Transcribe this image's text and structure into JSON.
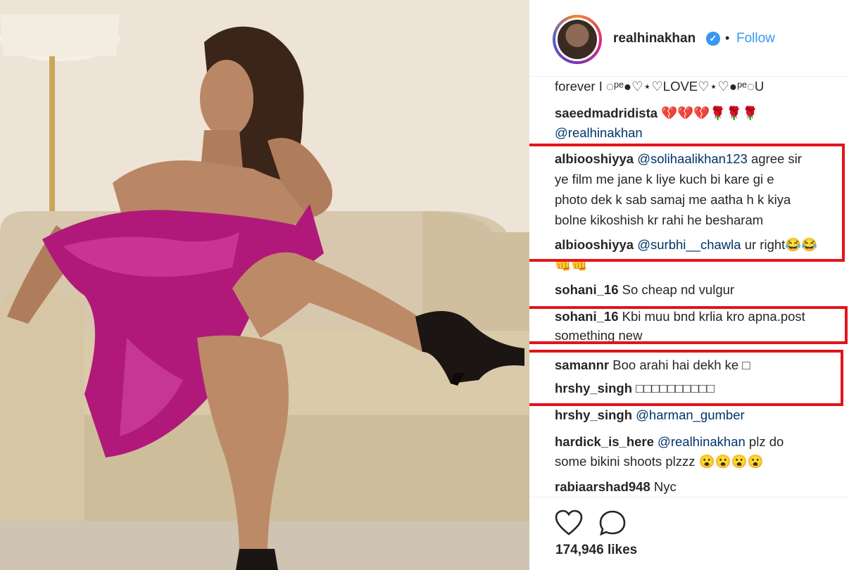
{
  "post": {
    "username": "realhinakhan",
    "verified_icon": "verified-badge-icon",
    "separator": "•",
    "follow_label": "Follow",
    "likes": "174,946 likes"
  },
  "comments": [
    {
      "user": "",
      "text": "forever I ◌ᵖᵉ●♡⋆♡LOVE♡⋆♡●ᵖᵉ◌U"
    },
    {
      "user": "saeedmadridista",
      "text": "💔💔💔🌹🌹🌹"
    },
    {
      "user": "",
      "text": "@realhinakhan"
    },
    {
      "user": "albiooshiyya",
      "mention": "@solihaalikhan123",
      "text": " agree sir"
    },
    {
      "user": "",
      "text": "ye film me jane k liye kuch bi kare gi e"
    },
    {
      "user": "",
      "text": "photo dek k sab samaj me aatha h k kiya"
    },
    {
      "user": "",
      "text": "bolne kikoshish kr rahi he besharam"
    },
    {
      "user": "albiooshiyya",
      "mention": "@surbhi__chawla",
      "text": " ur right😂😂"
    },
    {
      "user": "",
      "text": "👊👊"
    },
    {
      "user": "sohani_16",
      "text": " So cheap nd vulgur"
    },
    {
      "user": "sohani_16",
      "text": " Kbi muu bnd krlia kro apna.post"
    },
    {
      "user": "",
      "text": "something new"
    },
    {
      "user": "samannr",
      "text": " Boo arahi hai dekh ke □"
    },
    {
      "user": "hrshy_singh",
      "text": " □□□□□□□□□□"
    },
    {
      "user": "hrshy_singh",
      "mention": "@harman_gumber",
      "text": ""
    },
    {
      "user": "hardick_is_here",
      "mention": "@realhinakhan",
      "text": " plz do"
    },
    {
      "user": "",
      "text": "some bikini shoots plzzz 😮😮😮😮"
    },
    {
      "user": "rabiaarshad948",
      "text": " Nyc"
    }
  ],
  "colors": {
    "highlight": "#e3141a",
    "link": "#3897f0",
    "mention": "#003569",
    "dress": "#b0197a"
  }
}
